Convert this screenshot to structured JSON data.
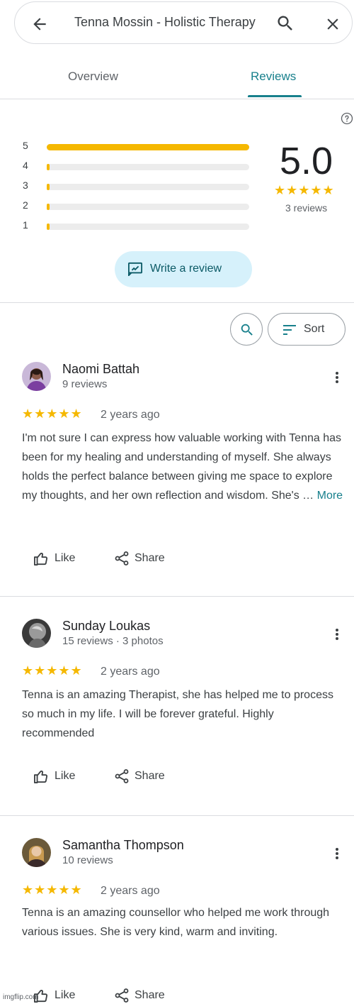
{
  "search": {
    "query": "Tenna Mossin - Holistic Therapy"
  },
  "tabs": [
    {
      "label": "Overview",
      "active": false
    },
    {
      "label": "Reviews",
      "active": true
    }
  ],
  "summary": {
    "histogram": [
      {
        "label": "5",
        "fraction": 1.0
      },
      {
        "label": "4",
        "fraction": 0.0
      },
      {
        "label": "3",
        "fraction": 0.0
      },
      {
        "label": "2",
        "fraction": 0.0
      },
      {
        "label": "1",
        "fraction": 0.0
      }
    ],
    "average": "5.0",
    "stars": "★★★★★",
    "count": "3 reviews",
    "write_review": "Write a review"
  },
  "controls": {
    "sort_label": "Sort"
  },
  "reviews": [
    {
      "name": "Naomi Battah",
      "meta": "9 reviews",
      "stars": "★★★★★",
      "date": "2 years ago",
      "text": "I'm not sure I can express how valuable working with Tenna has been for my healing and understanding of myself. She always holds the perfect balance between giving me space to explore my thoughts, and her own reflection and wisdom. She's … ",
      "more": "More",
      "like": "Like",
      "share": "Share"
    },
    {
      "name": "Sunday Loukas",
      "meta": "15 reviews · 3 photos",
      "stars": "★★★★★",
      "date": "2 years ago",
      "text": "Tenna is an amazing Therapist, she has helped me to process so much in my life. I will be forever grateful. Highly recommended",
      "like": "Like",
      "share": "Share"
    },
    {
      "name": "Samantha Thompson",
      "meta": "10 reviews",
      "stars": "★★★★★",
      "date": "2 years ago",
      "text": "Tenna is an amazing counsellor who helped me work through various issues. She is very kind, warm and inviting.",
      "like": "Like",
      "share": "Share"
    }
  ],
  "colors": {
    "accent": "#18808c",
    "star": "#f5b800",
    "write_bg": "#d6f1fb"
  },
  "watermark": "imgflip.com"
}
